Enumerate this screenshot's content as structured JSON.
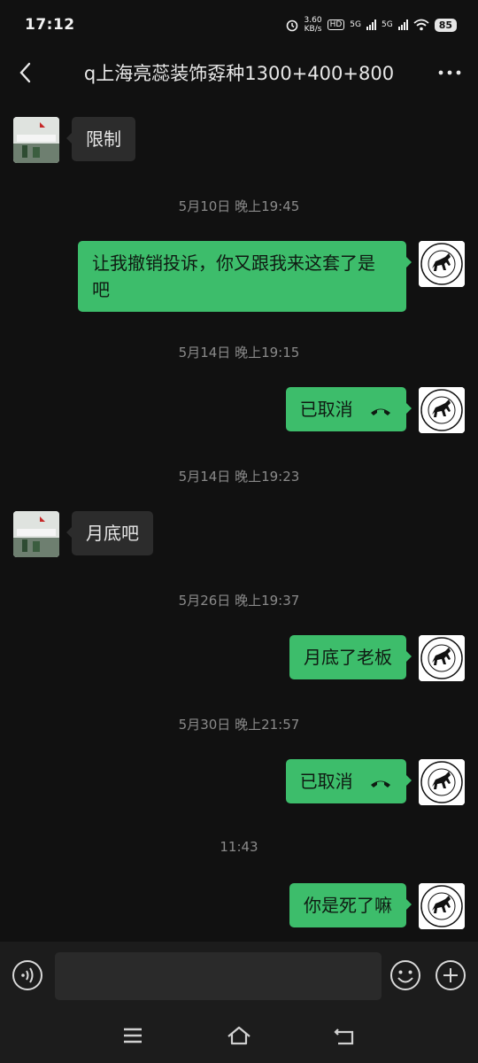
{
  "status_bar": {
    "time": "17:12",
    "net_speed_value": "3.60",
    "net_speed_unit": "KB/s",
    "hd_label": "HD",
    "network_1": "5G",
    "network_2": "5G",
    "battery": "85"
  },
  "header": {
    "title": "q上海亮蕊装饰孬种1300+400+800"
  },
  "messages": [
    {
      "type": "text",
      "side": "left",
      "text": "限制"
    },
    {
      "type": "timestamp",
      "text": "5月10日 晚上19:45"
    },
    {
      "type": "text",
      "side": "right",
      "text": "让我撤销投诉，你又跟我来这套了是吧"
    },
    {
      "type": "timestamp",
      "text": "5月14日 晚上19:15"
    },
    {
      "type": "call",
      "side": "right",
      "text": "已取消",
      "icon": "phone-hangup-icon"
    },
    {
      "type": "timestamp",
      "text": "5月14日 晚上19:23"
    },
    {
      "type": "text",
      "side": "left",
      "text": "月底吧"
    },
    {
      "type": "timestamp",
      "text": "5月26日 晚上19:37"
    },
    {
      "type": "text",
      "side": "right",
      "text": "月底了老板"
    },
    {
      "type": "timestamp",
      "text": "5月30日 晚上21:57"
    },
    {
      "type": "call",
      "side": "right",
      "text": "已取消",
      "icon": "phone-hangup-icon"
    },
    {
      "type": "timestamp",
      "text": "11:43"
    },
    {
      "type": "text",
      "side": "right",
      "text": "你是死了嘛"
    }
  ],
  "input_bar": {
    "voice_icon": "voice-icon",
    "emoji_icon": "emoji-icon",
    "plus_icon": "plus-icon",
    "placeholder": ""
  },
  "colors": {
    "background": "#111111",
    "bubble_self": "#3dbd6b",
    "bubble_other": "#2c2c2c",
    "timestamp": "#8a8a8a"
  }
}
